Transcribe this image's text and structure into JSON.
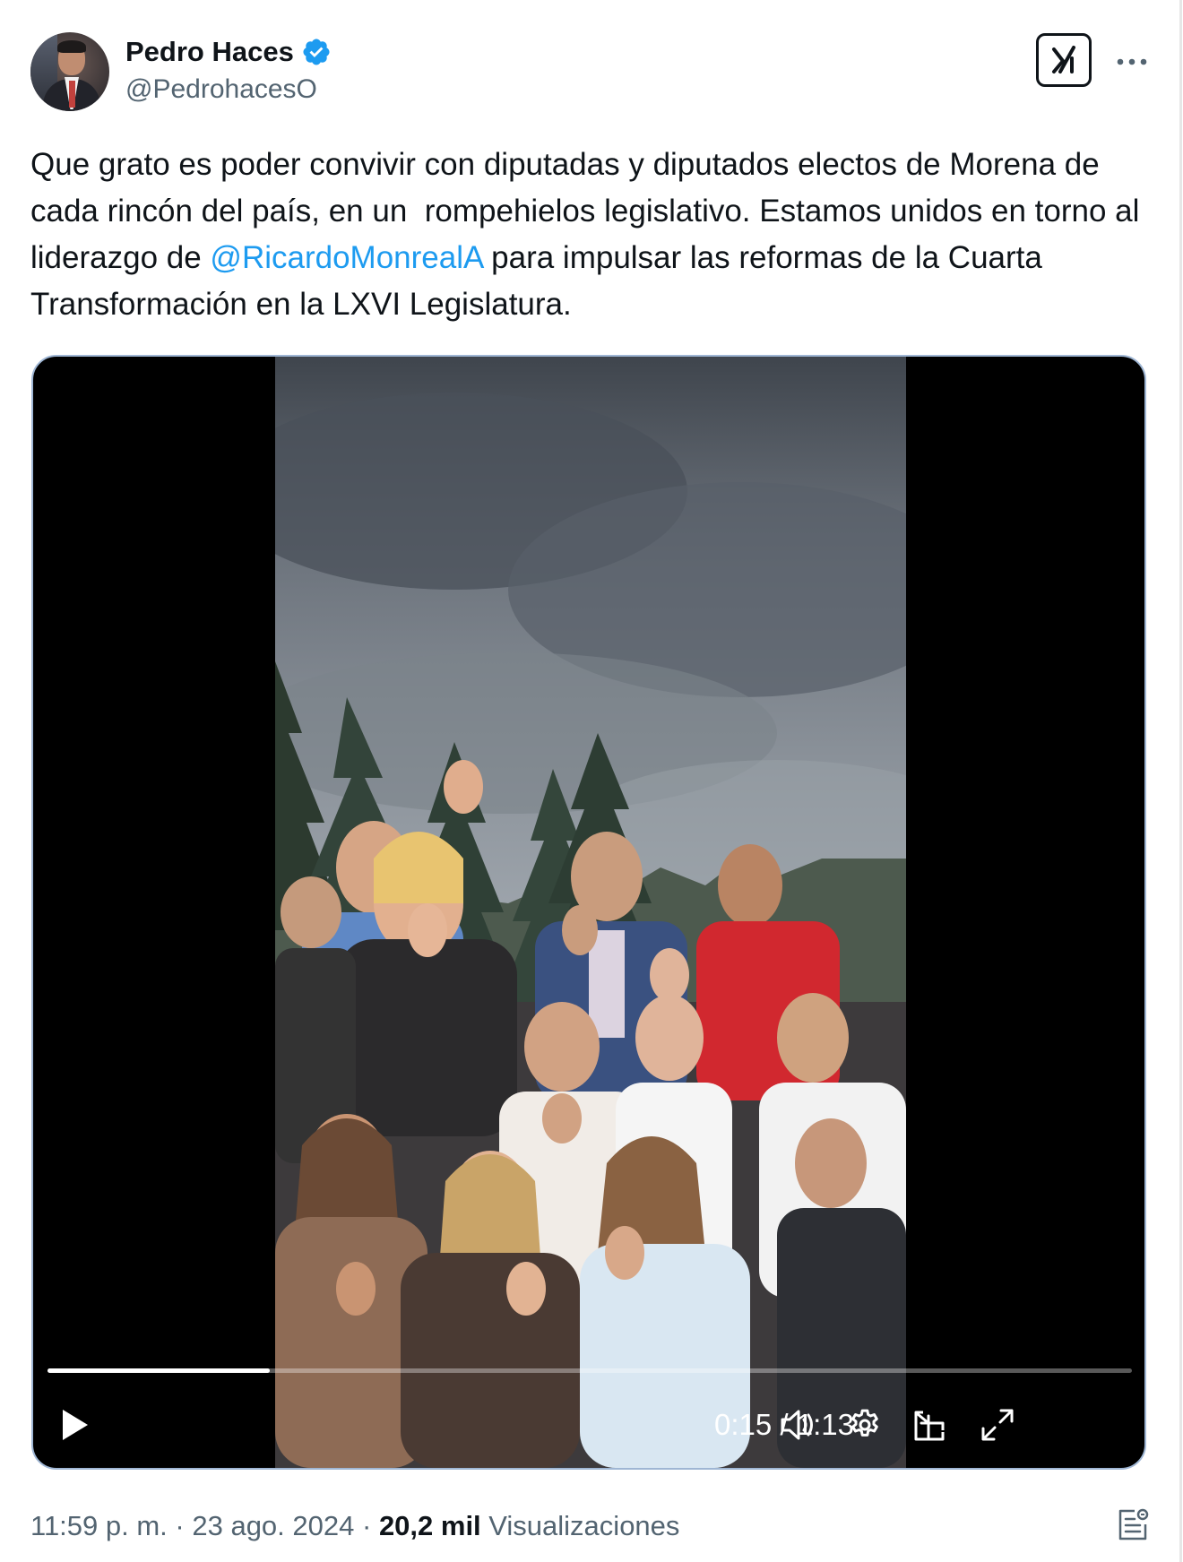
{
  "author": {
    "display_name": "Pedro Haces",
    "handle": "@PedrohacesO",
    "verified": true,
    "verified_color": "#1d9bf0"
  },
  "header": {
    "grok_icon": "grok-icon",
    "more_icon": "more-horizontal-icon"
  },
  "tweet": {
    "text_before": "Que grato es poder convivir con diputadas y diputados electos de Morena de cada rincón del país, en un  rompehielos legislativo. Estamos unidos en torno al liderazgo de ",
    "mention": "@RicardoMonrealA",
    "text_after": " para impulsar las reformas de la Cuarta Transformación en la LXVI Legislatura.",
    "mention_color": "#1d9bf0"
  },
  "video": {
    "current_time": "0:15",
    "separator": " / ",
    "duration": "1:13",
    "progress_fraction": 0.205,
    "controls": [
      "play-icon",
      "volume-icon",
      "settings-icon",
      "pip-icon",
      "fullscreen-icon"
    ]
  },
  "footer": {
    "time": "11:59 p. m.",
    "dot1": " · ",
    "date": "23 ago. 2024",
    "dot2": " · ",
    "views_count": "20,2 mil",
    "views_label": " Visualizaciones",
    "analytics_icon": "analytics-icon"
  }
}
